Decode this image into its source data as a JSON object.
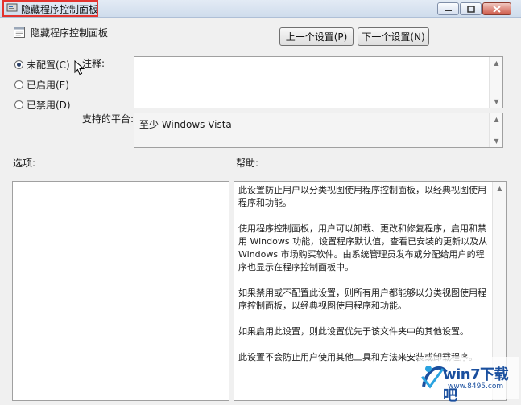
{
  "window": {
    "title": "隐藏程序控制面板"
  },
  "policy": {
    "name": "隐藏程序控制面板",
    "prev_button": "上一个设置(P)",
    "next_button": "下一个设置(N)"
  },
  "state_options": [
    {
      "label": "未配置(C)",
      "selected": true
    },
    {
      "label": "已启用(E)",
      "selected": false
    },
    {
      "label": "已禁用(D)",
      "selected": false
    }
  ],
  "comment": {
    "label": "注释:",
    "value": ""
  },
  "platform": {
    "label": "支持的平台:",
    "value": "至少 Windows Vista"
  },
  "options": {
    "label": "选项:"
  },
  "help": {
    "label": "帮助:",
    "paragraphs": [
      "此设置防止用户以分类视图使用程序控制面板，以经典视图使用程序和功能。",
      "使用程序控制面板，用户可以卸载、更改和修复程序，启用和禁用 Windows 功能，设置程序默认值，查看已安装的更新以及从 Windows 市场购买软件。由系统管理员发布或分配给用户的程序也显示在程序控制面板中。",
      "如果禁用或不配置此设置，则所有用户都能够以分类视图使用程序控制面板，以经典视图使用程序和功能。",
      "如果启用此设置，则此设置优先于该文件夹中的其他设置。",
      "此设置不会防止用户使用其他工具和方法来安装或卸载程序。"
    ]
  },
  "watermark": {
    "brand": "win7下载吧",
    "url": "www.8495.com"
  },
  "colors": {
    "highlight_border": "#e3342f",
    "watermark_blue": "#1a4f9e"
  }
}
